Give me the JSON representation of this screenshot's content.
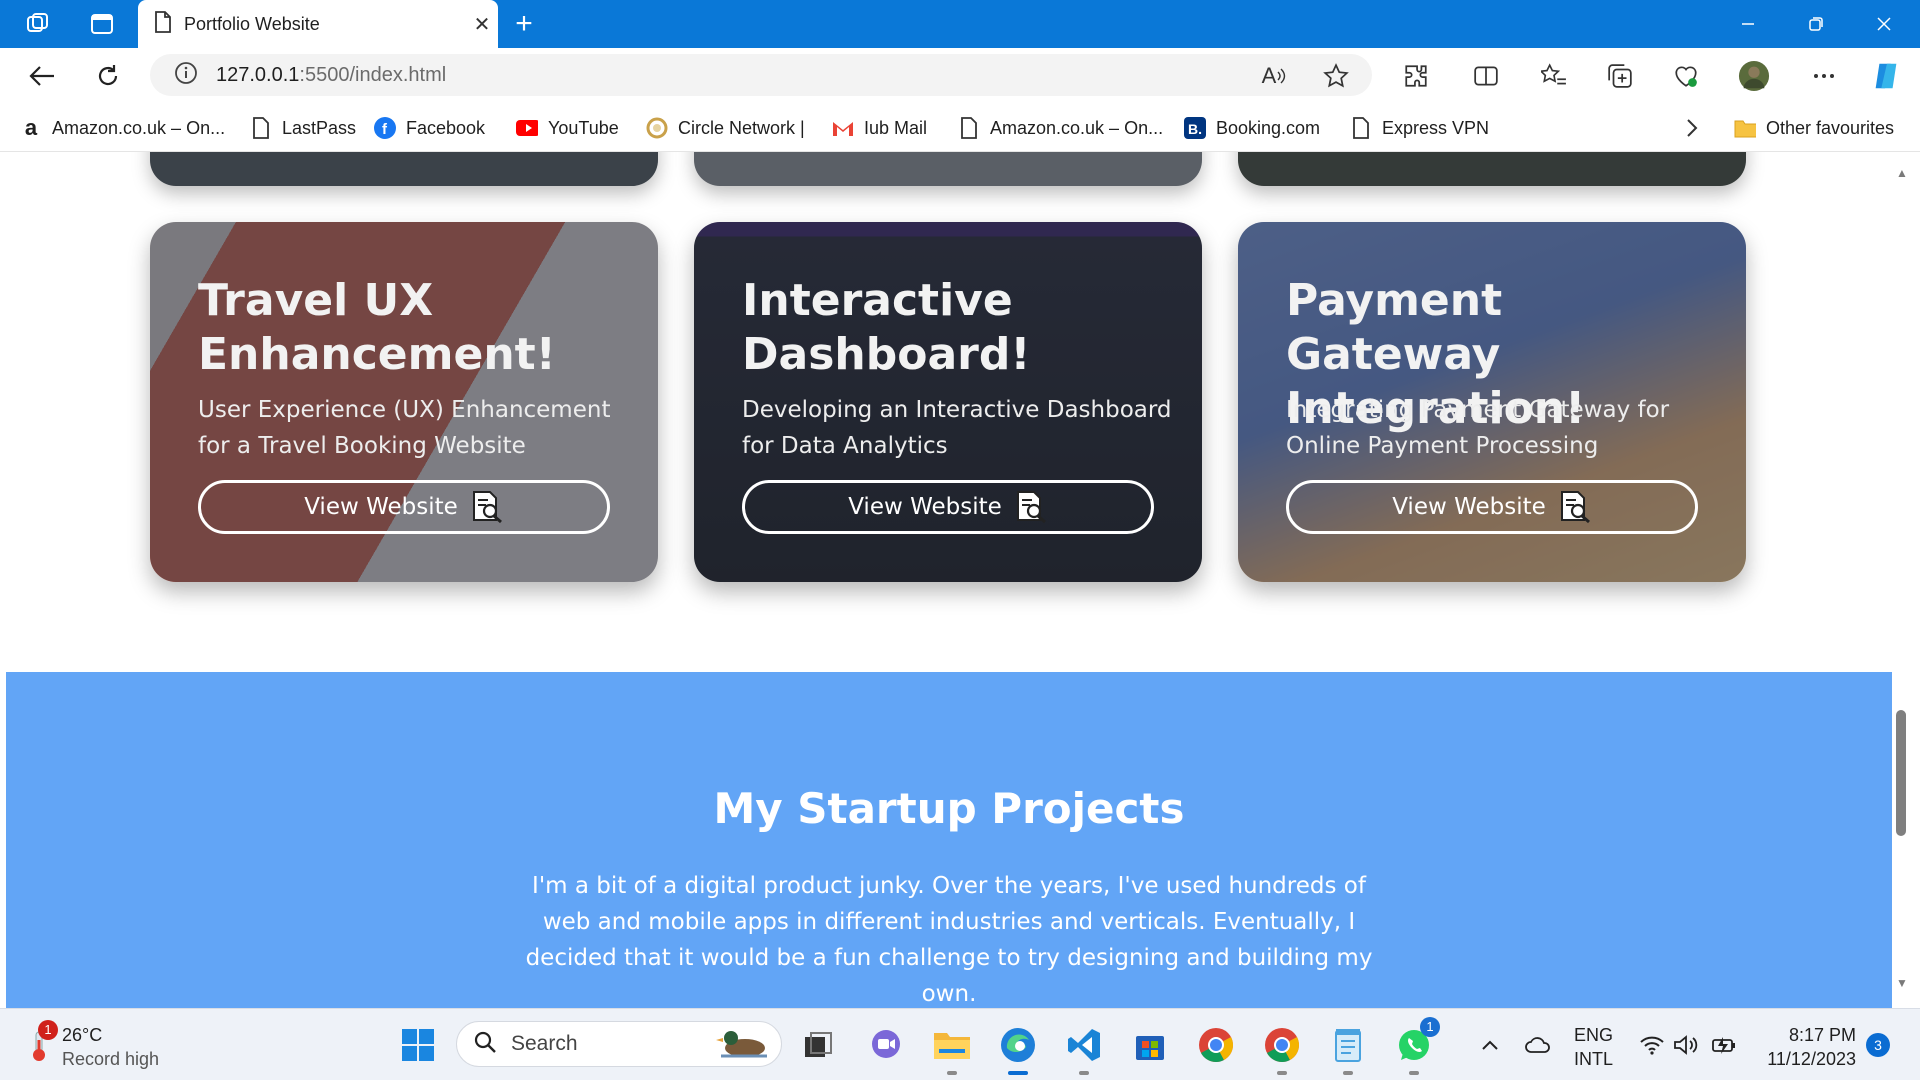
{
  "browser": {
    "tab_title": "Portfolio Website",
    "url_host": "127.0.0.1",
    "url_rest": ":5500/index.html",
    "read_aloud_label": "A",
    "favourites": [
      {
        "label": "Amazon.co.uk – On...",
        "icon": "amazon-icon"
      },
      {
        "label": "LastPass",
        "icon": "page-icon"
      },
      {
        "label": "Facebook",
        "icon": "facebook-icon"
      },
      {
        "label": "YouTube",
        "icon": "youtube-icon"
      },
      {
        "label": "Circle Network |",
        "icon": "circle-network-icon"
      },
      {
        "label": "Iub Mail",
        "icon": "gmail-icon"
      },
      {
        "label": "Amazon.co.uk – On...",
        "icon": "page-icon"
      },
      {
        "label": "Booking.com",
        "icon": "booking-icon"
      },
      {
        "label": "Express VPN",
        "icon": "page-icon"
      }
    ],
    "other_favourites": "Other favourites"
  },
  "projects": {
    "cards": [
      {
        "title": "Travel UX Enhancement!",
        "description": "User Experience (UX) Enhancement for a Travel Booking Website",
        "button": "View Website",
        "bg_color": "#d9583b"
      },
      {
        "title": "Interactive Dashboard!",
        "description": "Developing an Interactive Dashboard for Data Analytics",
        "button": "View Website",
        "bg_color": "#2b2f3e"
      },
      {
        "title": "Payment Gateway Integration!",
        "description": "Integrating Payment Gateway for Online Payment Processing",
        "button": "View Website",
        "bg_color": "#3d5a8c"
      }
    ]
  },
  "startup": {
    "title": "My Startup Projects",
    "text": "I'm a bit of a digital product junky. Over the years, I've used hundreds of web and mobile apps in different industries and verticals. Eventually, I decided that it would be a fun challenge to try designing and building my own.",
    "bg_color": "#62a5f6"
  },
  "taskbar": {
    "weather_temp": "26°C",
    "weather_desc": "Record high",
    "weather_badge": "1",
    "search_label": "Search",
    "whatsapp_badge": "1",
    "lang_line1": "ENG",
    "lang_line2": "INTL",
    "time": "8:17 PM",
    "date": "11/12/2023",
    "notification_count": "3"
  }
}
